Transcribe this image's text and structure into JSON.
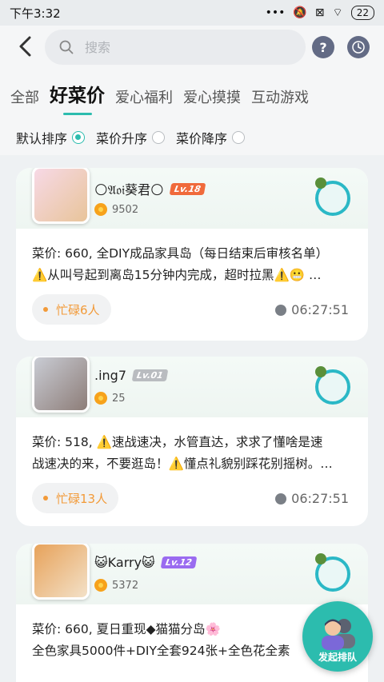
{
  "status_bar": {
    "time": "下午3:32",
    "dots": "•••",
    "battery": "22"
  },
  "search": {
    "placeholder": "搜索"
  },
  "header": {
    "help": "?",
    "history_icon": "clock-icon"
  },
  "tabs": [
    {
      "label": "全部"
    },
    {
      "label": "好菜价"
    },
    {
      "label": "爱心福利"
    },
    {
      "label": "爱心摸摸"
    },
    {
      "label": "互动游戏"
    }
  ],
  "sort": [
    {
      "label": "默认排序",
      "selected": true
    },
    {
      "label": "菜价升序",
      "selected": false
    },
    {
      "label": "菜价降序",
      "selected": false
    }
  ],
  "posts": [
    {
      "user": "🌕𝔄𝔬𝔦葵君🌕",
      "level": "Lv.18",
      "level_color": "#f06a3b",
      "points": "9502",
      "line1": "菜价: 660, 全DIY成品家具岛（每日结束后审核名单）",
      "line2": "⚠️从叫号起到离岛15分钟内完成，超时拉黑⚠️😬  …",
      "busy": "忙碌6人",
      "time": "06:27:51"
    },
    {
      "user": ".ing7",
      "level": "Lv.01",
      "level_color": "#b9bcc0",
      "points": "25",
      "line1": "菜价: 518, ⚠️速战速决，水管直达，求求了懂啥是速",
      "line2": "战速决的来，不要逛岛！⚠️懂点礼貌别踩花别摇树。…",
      "busy": "忙碌13人",
      "time": "06:27:51"
    },
    {
      "user": "😺Karry😺",
      "level": "Lv.12",
      "level_color": "#9a6bf0",
      "points": "5372",
      "line1": "菜价: 660, 夏日重现◆猫猫分岛🌸",
      "line2": "全色家具5000件+DIY全套924张+全色花全素",
      "busy": "",
      "time": ""
    }
  ],
  "fab": {
    "label": "发起排队"
  }
}
